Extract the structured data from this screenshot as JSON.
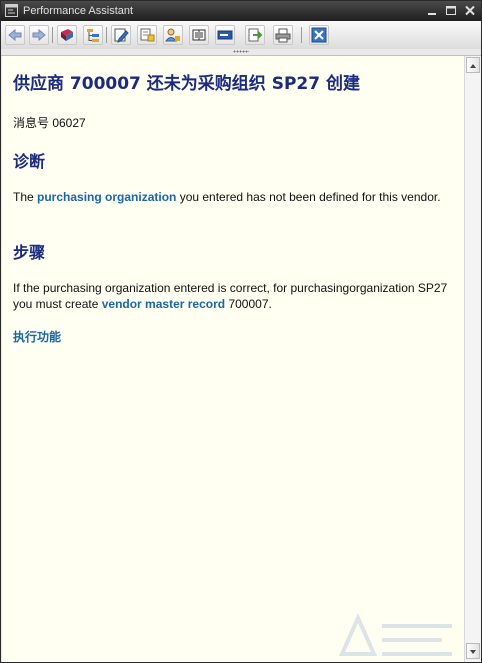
{
  "window": {
    "title": "Performance Assistant"
  },
  "toolbar": {
    "buttons": [
      {
        "name": "back-button",
        "icon": "arrow-left-icon"
      },
      {
        "name": "forward-button",
        "icon": "arrow-right-icon"
      },
      {
        "name": "technical-info-button",
        "icon": "book-icon"
      },
      {
        "name": "navigation-button",
        "icon": "hierarchy-icon"
      },
      {
        "name": "edit-button",
        "icon": "pencil-icon"
      },
      {
        "name": "help-button",
        "icon": "help-document-icon"
      },
      {
        "name": "user-settings-button",
        "icon": "user-icon"
      },
      {
        "name": "glossary-button",
        "icon": "open-book-icon"
      },
      {
        "name": "long-text-button",
        "icon": "text-tag-icon"
      },
      {
        "name": "export-button",
        "icon": "document-export-icon"
      },
      {
        "name": "print-button",
        "icon": "printer-icon"
      },
      {
        "name": "close-button",
        "icon": "close-icon"
      }
    ]
  },
  "message": {
    "title": "供应商 700007 还未为采购组织 SP27 创建",
    "number_label": "消息号 06027",
    "diagnosis_heading": "诊断",
    "diagnosis": {
      "before": "The ",
      "link": "purchasing organization",
      "after": " you entered has not been defined for this vendor."
    },
    "procedure_heading": "步骤",
    "procedure": {
      "before": "If the purchasing organization entered is correct, for purchasingorganization SP27 you must create ",
      "link": "vendor master record",
      "after": " 700007."
    },
    "execute_link": "执行功能"
  },
  "colors": {
    "heading": "#1b2b80",
    "link": "#1a66a8",
    "background": "#fffff2"
  }
}
